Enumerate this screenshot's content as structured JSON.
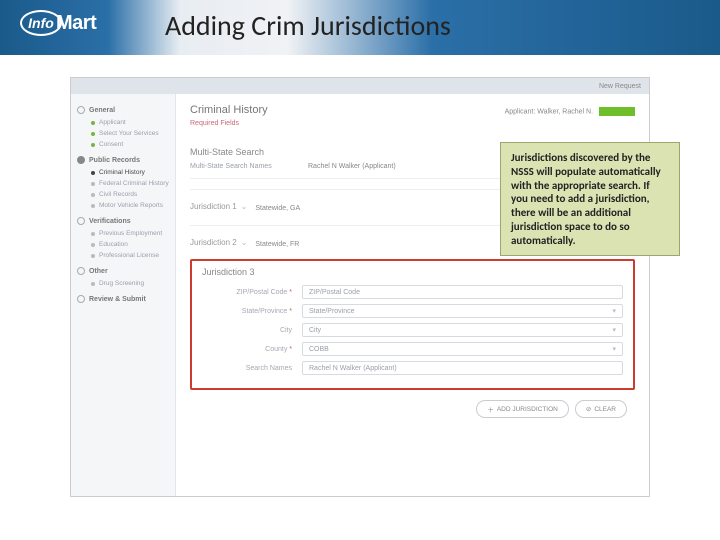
{
  "slide": {
    "title": "Adding Crim Jurisdictions"
  },
  "logo": {
    "oval": "Info",
    "rest": "Mart"
  },
  "breadcrumb": {
    "id": "",
    "path": "New Request"
  },
  "sidebar": {
    "groups": [
      {
        "title": "General",
        "filled": false,
        "items": [
          {
            "label": "Applicant",
            "color": "green"
          },
          {
            "label": "Select Your Services",
            "color": "green"
          },
          {
            "label": "Consent",
            "color": "green"
          }
        ]
      },
      {
        "title": "Public Records",
        "filled": true,
        "items": [
          {
            "label": "Criminal History",
            "color": "dark",
            "active": true
          },
          {
            "label": "Federal Criminal History",
            "color": ""
          },
          {
            "label": "Civil Records",
            "color": ""
          },
          {
            "label": "Motor Vehicle Reports",
            "color": ""
          }
        ]
      },
      {
        "title": "Verifications",
        "filled": false,
        "items": [
          {
            "label": "Previous Employment",
            "color": ""
          },
          {
            "label": "Education",
            "color": ""
          },
          {
            "label": "Professional License",
            "color": ""
          }
        ]
      },
      {
        "title": "Other",
        "filled": false,
        "items": [
          {
            "label": "Drug Screening",
            "color": ""
          }
        ]
      },
      {
        "title": "Review & Submit",
        "filled": false,
        "items": []
      }
    ]
  },
  "main": {
    "title": "Criminal History",
    "applicant_label": "Applicant:",
    "applicant_name": "Walker, Rachel N.",
    "required_link": "Required Fields",
    "section": "Multi-State Search",
    "mss_row": {
      "label": "Multi-State Search Names",
      "value": "Rachel N Walker (Applicant)"
    },
    "jur1": {
      "title": "Jurisdiction 1",
      "value": "Statewide, GA"
    },
    "jur2": {
      "title": "Jurisdiction 2",
      "value": "Statewide, FR"
    },
    "jur3": {
      "title": "Jurisdiction 3",
      "fields": [
        {
          "label": "ZIP/Postal Code",
          "req": true,
          "placeholder": "ZIP/Postal Code",
          "dropdown": false
        },
        {
          "label": "State/Province",
          "req": true,
          "placeholder": "State/Province",
          "dropdown": true
        },
        {
          "label": "City",
          "req": false,
          "placeholder": "City",
          "dropdown": true
        },
        {
          "label": "County",
          "req": true,
          "placeholder": "COBB",
          "dropdown": true
        },
        {
          "label": "Search Names",
          "req": false,
          "placeholder": "Rachel N Walker (Applicant)",
          "dropdown": false
        }
      ]
    },
    "buttons": {
      "add": "ADD JURISDICTION",
      "clear": "CLEAR"
    }
  },
  "callout": {
    "text": "Jurisdictions discovered by the NSSS will populate automatically with the appropriate search.  If you need to add a jurisdiction, there will be an additional jurisdiction space to do so automatically."
  }
}
